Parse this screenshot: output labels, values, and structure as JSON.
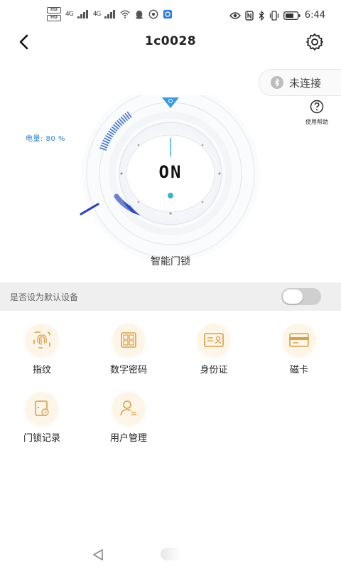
{
  "status_bar": {
    "sim1": "HD",
    "sim2": "HD",
    "net1": "4G",
    "net2": "4G",
    "time": "6:44",
    "icons": [
      "wifi-icon",
      "qq-icon",
      "browser-icon",
      "app-icon",
      "eye-icon",
      "nfc-icon",
      "bluetooth-icon",
      "vibrate-icon",
      "battery-icon"
    ]
  },
  "header": {
    "title": "1c0028",
    "back_icon": "chevron-left-icon",
    "settings_icon": "gear-icon"
  },
  "connection": {
    "status_text": "未连接",
    "icon": "bluetooth-icon"
  },
  "help": {
    "label": "使用帮助",
    "icon": "question-circle-icon"
  },
  "battery": {
    "label": "电量: 80 %",
    "level_percent": 80
  },
  "lock": {
    "state": "ON",
    "device_name": "智能门锁"
  },
  "default_device": {
    "label": "是否设为默认设备",
    "enabled": false
  },
  "features": [
    {
      "label": "指纹",
      "icon": "fingerprint-icon"
    },
    {
      "label": "数字密码",
      "icon": "keypad-icon"
    },
    {
      "label": "身份证",
      "icon": "id-card-icon"
    },
    {
      "label": "磁卡",
      "icon": "card-icon"
    },
    {
      "label": "门锁记录",
      "icon": "lock-record-icon"
    },
    {
      "label": "用户管理",
      "icon": "user-manage-icon"
    }
  ],
  "colors": {
    "accent_blue": "#2f7fd6",
    "ring_dark": "#2a3fb5",
    "ring_light": "#3ab0f0",
    "icon_gold": "#d9a04a",
    "icon_bg": "#fdf5e8"
  }
}
